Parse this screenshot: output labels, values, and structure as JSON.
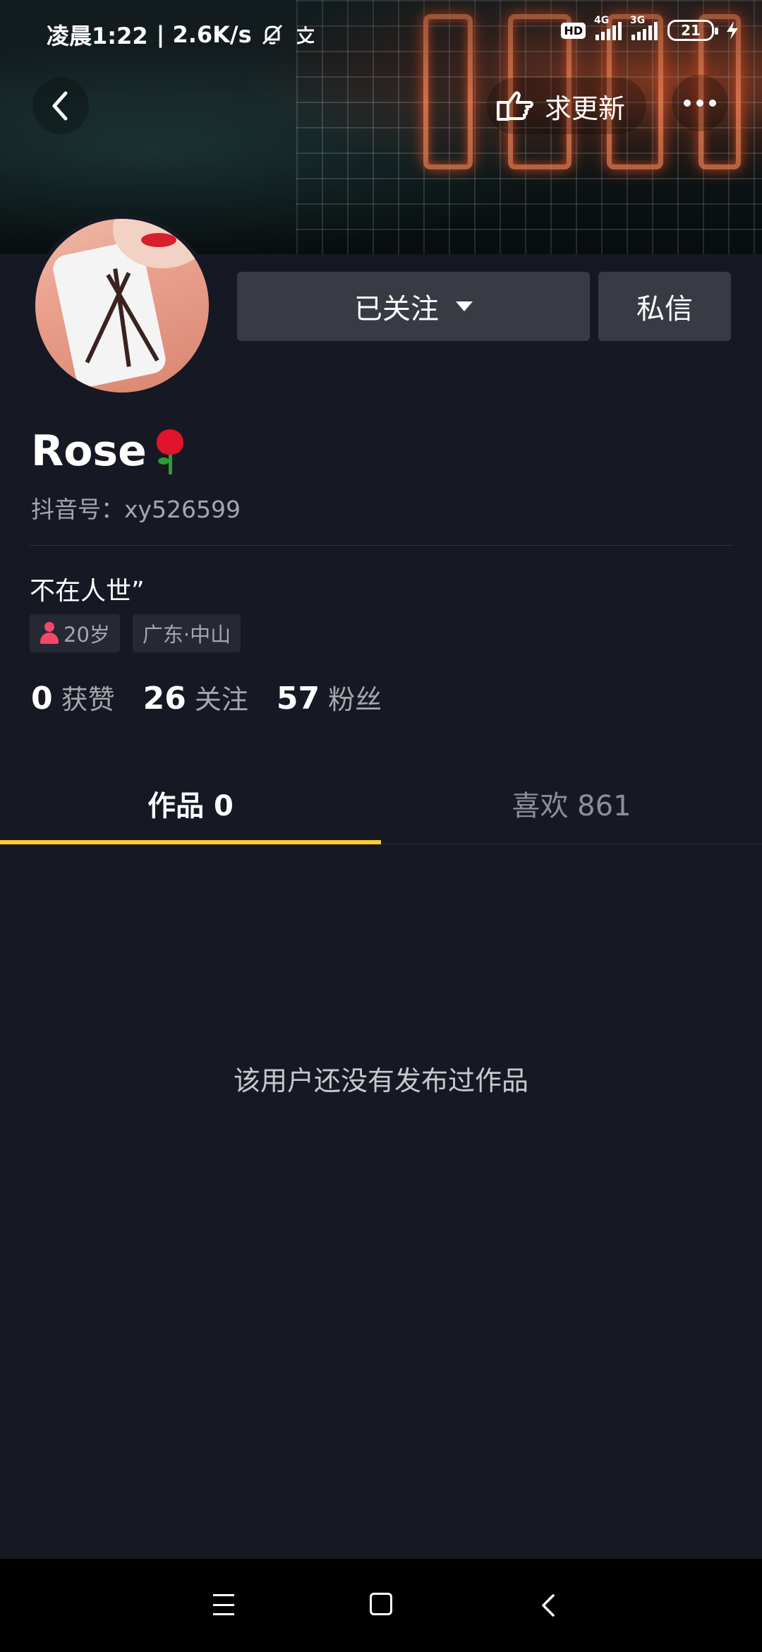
{
  "status_bar": {
    "time": "凌晨1:22",
    "speed": "| 2.6K/s",
    "hd": "HD",
    "sig1_label": "4G",
    "sig2_label": "3G",
    "battery": "21"
  },
  "nav": {
    "update_label": "求更新"
  },
  "buttons": {
    "followed_label": "已关注",
    "message_label": "私信"
  },
  "profile": {
    "name": "Rose",
    "douyin_id": "抖音号：xy526599",
    "bio": "不在人世”",
    "age_tag": "20岁",
    "location_tag": "广东·中山"
  },
  "stats": [
    {
      "value": "0",
      "label": "获赞"
    },
    {
      "value": "26",
      "label": "关注"
    },
    {
      "value": "57",
      "label": "粉丝"
    }
  ],
  "tabs": [
    {
      "label": "作品 0"
    },
    {
      "label": "喜欢 861"
    }
  ],
  "empty_message": "该用户还没有发布过作品"
}
